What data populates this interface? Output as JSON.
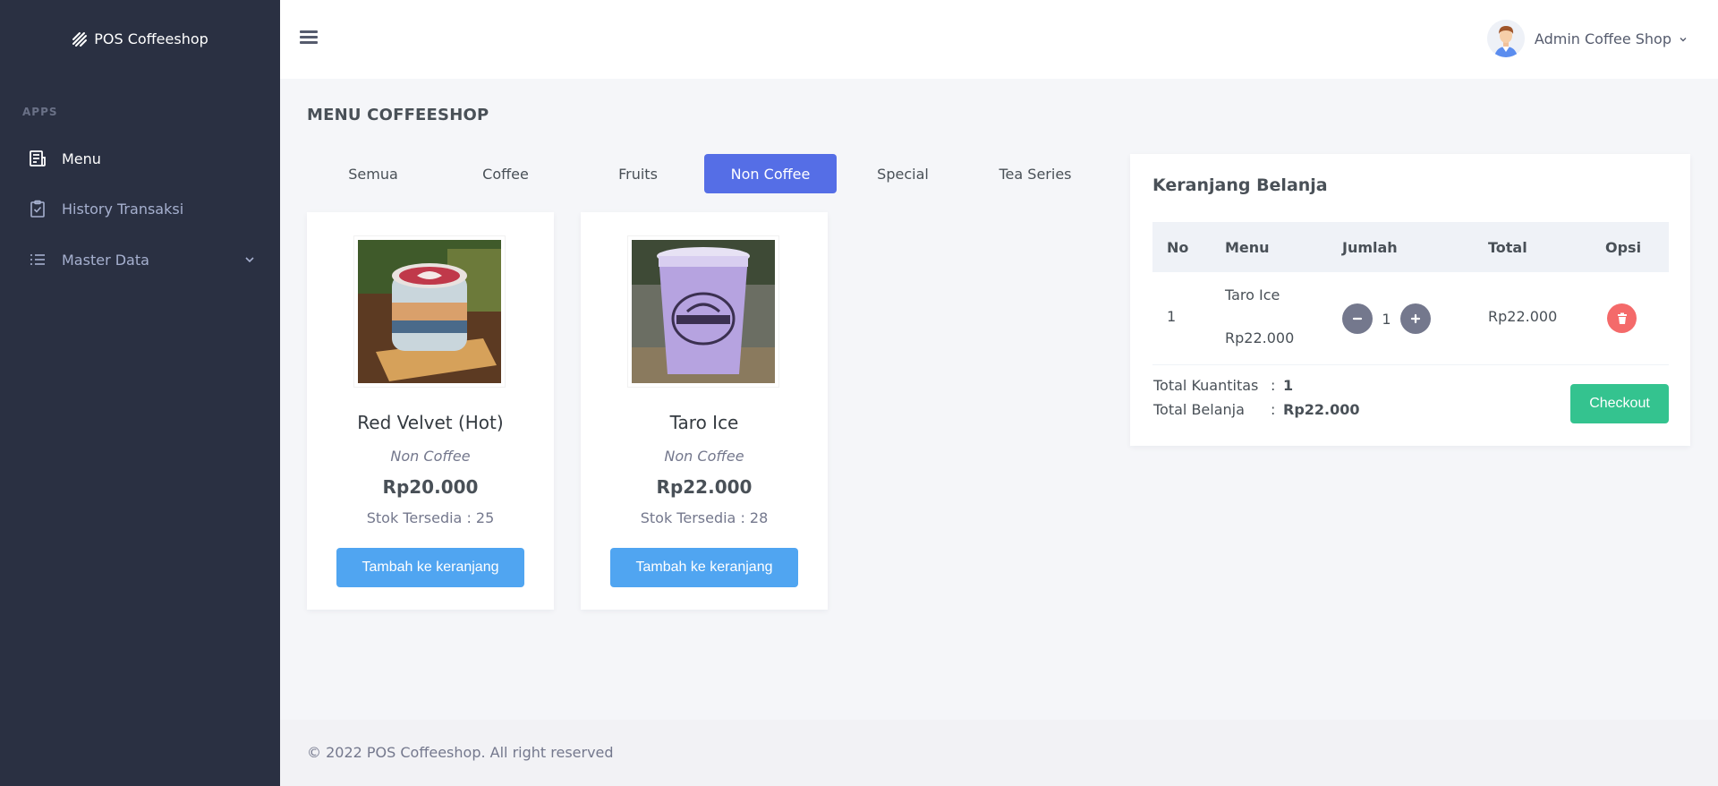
{
  "brand": {
    "name": "POS Coffeeshop"
  },
  "sidebar": {
    "section": "APPS",
    "items": [
      {
        "label": "Menu",
        "icon": "receipt-icon"
      },
      {
        "label": "History Transaksi",
        "icon": "clipboard-check-icon"
      },
      {
        "label": "Master Data",
        "icon": "list-icon"
      }
    ]
  },
  "header": {
    "user_name": "Admin Coffee Shop"
  },
  "page": {
    "title": "MENU COFFEESHOP"
  },
  "tabs": [
    "Semua",
    "Coffee",
    "Fruits",
    "Non Coffee",
    "Special",
    "Tea Series"
  ],
  "active_tab": "Non Coffee",
  "products": [
    {
      "name": "Red Velvet (Hot)",
      "category": "Non Coffee",
      "price": "Rp20.000",
      "stock": "Stok Tersedia : 25",
      "button": "Tambah ke keranjang"
    },
    {
      "name": "Taro Ice",
      "category": "Non Coffee",
      "price": "Rp22.000",
      "stock": "Stok Tersedia : 28",
      "button": "Tambah ke keranjang"
    }
  ],
  "cart": {
    "title": "Keranjang Belanja",
    "columns": [
      "No",
      "Menu",
      "Jumlah",
      "Total",
      "Opsi"
    ],
    "rows": [
      {
        "no": "1",
        "menu": "Taro Ice",
        "unit_price": "Rp22.000",
        "qty": "1",
        "total": "Rp22.000"
      }
    ],
    "summary": {
      "qty_label": "Total Kuantitas",
      "qty_value": "1",
      "total_label": "Total Belanja",
      "total_value": "Rp22.000",
      "separator": ":"
    },
    "checkout_label": "Checkout"
  },
  "footer": {
    "text": "© 2022 POS Coffeeshop. All right reserved"
  },
  "colors": {
    "sidebar_bg": "#2a3042",
    "primary": "#556ee6",
    "info": "#50a5f1",
    "success": "#34c38f",
    "danger": "#f46a6a"
  }
}
